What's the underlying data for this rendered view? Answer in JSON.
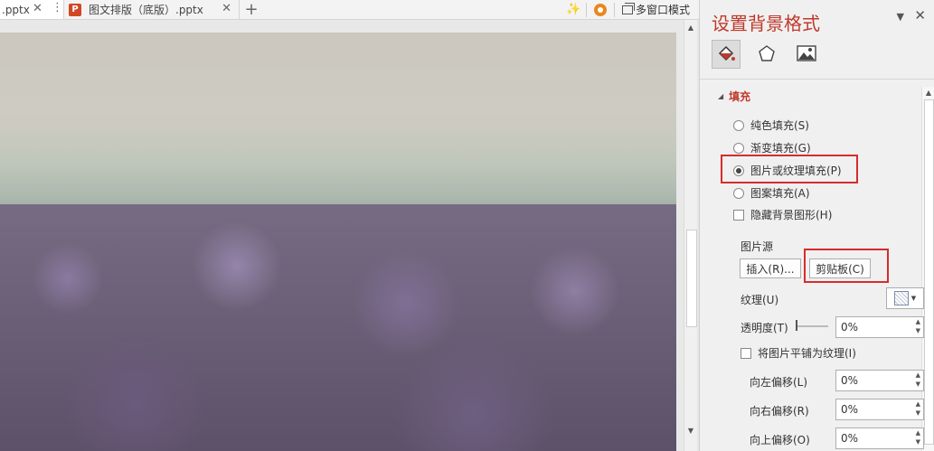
{
  "tabs": [
    {
      "label": ".pptx",
      "close": "✕",
      "more": "⋮"
    },
    {
      "icon_text": "P",
      "label": "图文排版（底版）.pptx",
      "close": "✕"
    }
  ],
  "new_tab": "+",
  "toolbar": {
    "wand_glyph": "✨",
    "multi_window_label": "多窗口模式"
  },
  "icons": {
    "wand": "magic-wand-icon",
    "gear": "gear-icon",
    "multi_window": "multi-window-icon",
    "fill": "paint-bucket-icon",
    "effects": "pentagon-icon",
    "picture": "picture-icon"
  },
  "panel": {
    "title": "设置背景格式",
    "pin": "▼",
    "close": "✕",
    "section_toggle": "◢",
    "section_title": "填充",
    "fill_options": [
      {
        "label": "纯色填充(S)",
        "selected": false
      },
      {
        "label": "渐变填充(G)",
        "selected": false
      },
      {
        "label": "图片或纹理填充(P)",
        "selected": true
      },
      {
        "label": "图案填充(A)",
        "selected": false
      }
    ],
    "hide_bg_graphics": "隐藏背景图形(H)",
    "picture_source_label": "图片源",
    "insert_button": "插入(R)...",
    "clipboard_button": "剪贴板(C)",
    "texture_label": "纹理(U)",
    "texture_caret": "▼",
    "transparency_label": "透明度(T)",
    "transparency_value": "0%",
    "tile_label": "将图片平铺为纹理(I)",
    "offsets": [
      {
        "label": "向左偏移(L)",
        "value": "0%"
      },
      {
        "label": "向右偏移(R)",
        "value": "0%"
      },
      {
        "label": "向上偏移(O)",
        "value": "0%"
      }
    ]
  },
  "highlight_color": "#d62c2c",
  "accent_color": "#c0392b"
}
